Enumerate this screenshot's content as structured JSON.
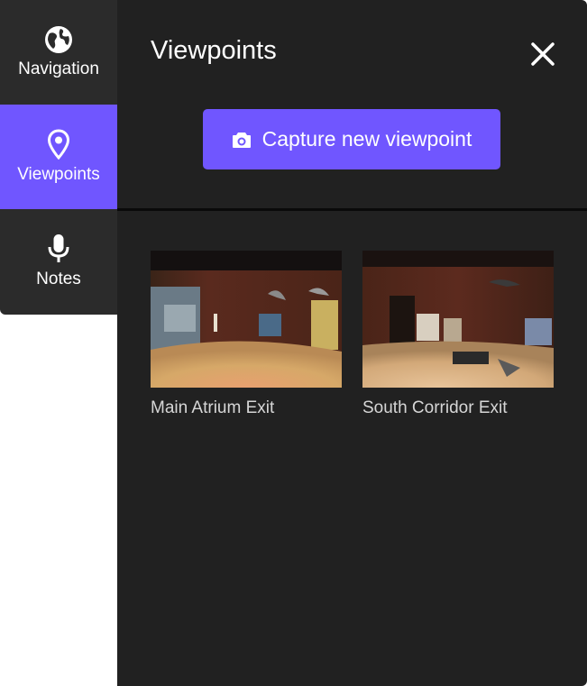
{
  "rail": {
    "items": [
      {
        "label": "Navigation",
        "icon": "globe-icon"
      },
      {
        "label": "Viewpoints",
        "icon": "map-pin-icon"
      },
      {
        "label": "Notes",
        "icon": "microphone-icon"
      }
    ],
    "active_index": 1
  },
  "panel": {
    "title": "Viewpoints",
    "close_icon": "close-icon",
    "capture_label": "Capture new viewpoint",
    "capture_icon": "camera-icon"
  },
  "viewpoints": [
    {
      "name": "Main Atrium Exit"
    },
    {
      "name": "South Corridor Exit"
    }
  ],
  "colors": {
    "accent": "#7056ff",
    "rail_bg": "#2b2b2b",
    "panel_bg": "#212121",
    "caption": "#d6d6d6"
  }
}
